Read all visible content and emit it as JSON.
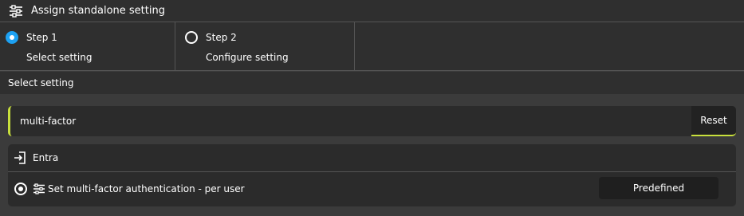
{
  "header": {
    "title": "Assign standalone setting",
    "icon": "sliders-icon"
  },
  "steps": [
    {
      "title": "Step 1",
      "subtitle": "Select setting",
      "state": "active"
    },
    {
      "title": "Step 2",
      "subtitle": "Configure setting",
      "state": "inactive"
    }
  ],
  "section": {
    "label": "Select setting"
  },
  "search": {
    "value": "multi-factor",
    "reset_label": "Reset"
  },
  "results": {
    "group": {
      "label": "Entra",
      "icon": "sign-in-icon"
    },
    "items": [
      {
        "label": "Set multi-factor authentication - per user",
        "icon": "sliders-icon",
        "badge": "Predefined"
      }
    ]
  },
  "colors": {
    "accent": "#c8e03c",
    "step_active": "#1da1f2",
    "background": "#3b3b3b",
    "panel": "#2b2b2b"
  }
}
